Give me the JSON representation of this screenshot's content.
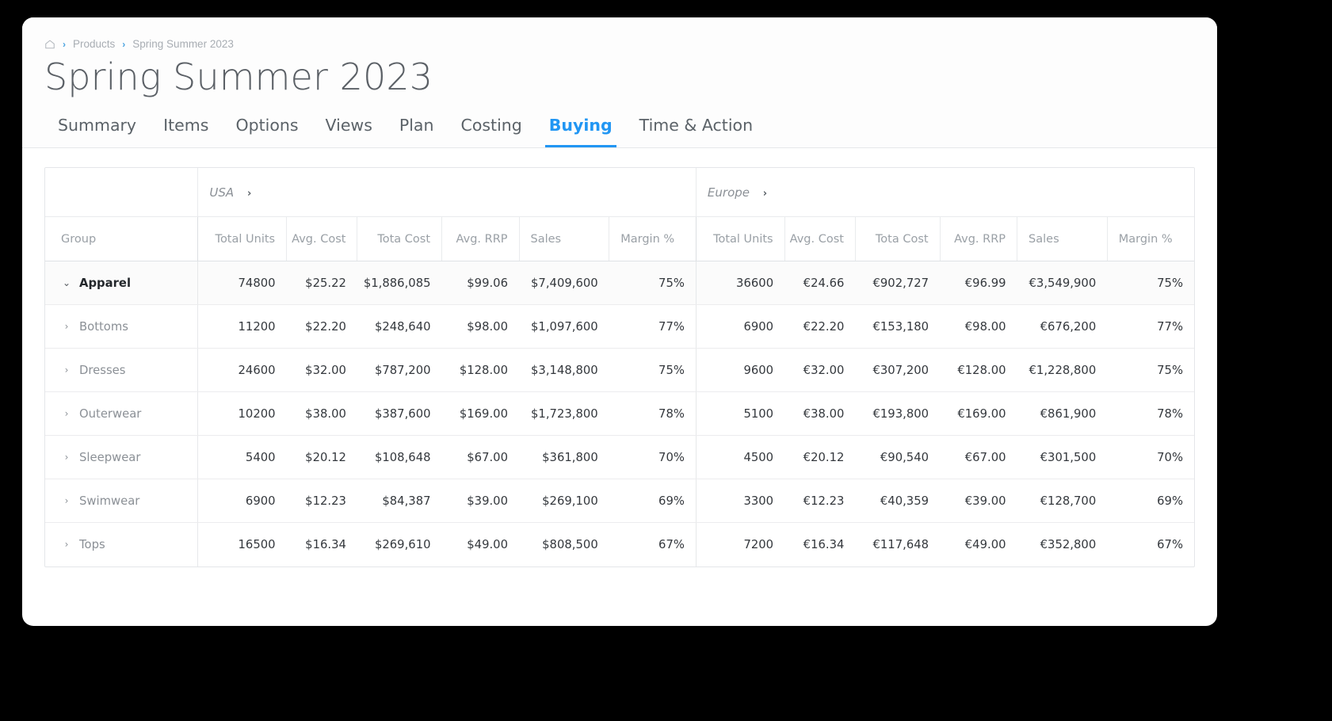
{
  "breadcrumb": {
    "home_icon": "home-icon",
    "separator": "›",
    "items": [
      "Products",
      "Spring Summer 2023"
    ]
  },
  "header": {
    "title": "Spring Summer 2023"
  },
  "tabs": [
    {
      "label": "Summary",
      "active": false
    },
    {
      "label": "Items",
      "active": false
    },
    {
      "label": "Options",
      "active": false
    },
    {
      "label": "Views",
      "active": false
    },
    {
      "label": "Plan",
      "active": false
    },
    {
      "label": "Costing",
      "active": false
    },
    {
      "label": "Buying",
      "active": true
    },
    {
      "label": "Time & Action",
      "active": false
    }
  ],
  "colors": {
    "accent": "#2196f3",
    "title_text": "#5b6066",
    "muted_text": "#9aa0a6",
    "body_text": "#34383d",
    "border": "#e4e6e9",
    "parent_row_bg": "#fbfbfb"
  },
  "table": {
    "regions": [
      {
        "name": "USA",
        "chevron": "›",
        "currency": "$"
      },
      {
        "name": "Europe",
        "chevron": "›",
        "currency": "€"
      }
    ],
    "group_header": "Group",
    "metric_headers": [
      "Total Units",
      "Avg. Cost",
      "Tota Cost",
      "Avg. RRP",
      "Sales",
      "Margin %"
    ],
    "rows": [
      {
        "group": "Apparel",
        "level": 0,
        "expanded": true,
        "chevron": "⌄",
        "usa": [
          "74800",
          "$25.22",
          "$1,886,085",
          "$99.06",
          "$7,409,600",
          "75%"
        ],
        "europe": [
          "36600",
          "€24.66",
          "€902,727",
          "€96.99",
          "€3,549,900",
          "75%"
        ]
      },
      {
        "group": "Bottoms",
        "level": 1,
        "expanded": false,
        "chevron": "›",
        "usa": [
          "11200",
          "$22.20",
          "$248,640",
          "$98.00",
          "$1,097,600",
          "77%"
        ],
        "europe": [
          "6900",
          "€22.20",
          "€153,180",
          "€98.00",
          "€676,200",
          "77%"
        ]
      },
      {
        "group": "Dresses",
        "level": 1,
        "expanded": false,
        "chevron": "›",
        "usa": [
          "24600",
          "$32.00",
          "$787,200",
          "$128.00",
          "$3,148,800",
          "75%"
        ],
        "europe": [
          "9600",
          "€32.00",
          "€307,200",
          "€128.00",
          "€1,228,800",
          "75%"
        ]
      },
      {
        "group": "Outerwear",
        "level": 1,
        "expanded": false,
        "chevron": "›",
        "usa": [
          "10200",
          "$38.00",
          "$387,600",
          "$169.00",
          "$1,723,800",
          "78%"
        ],
        "europe": [
          "5100",
          "€38.00",
          "€193,800",
          "€169.00",
          "€861,900",
          "78%"
        ]
      },
      {
        "group": "Sleepwear",
        "level": 1,
        "expanded": false,
        "chevron": "›",
        "usa": [
          "5400",
          "$20.12",
          "$108,648",
          "$67.00",
          "$361,800",
          "70%"
        ],
        "europe": [
          "4500",
          "€20.12",
          "€90,540",
          "€67.00",
          "€301,500",
          "70%"
        ]
      },
      {
        "group": "Swimwear",
        "level": 1,
        "expanded": false,
        "chevron": "›",
        "usa": [
          "6900",
          "$12.23",
          "$84,387",
          "$39.00",
          "$269,100",
          "69%"
        ],
        "europe": [
          "3300",
          "€12.23",
          "€40,359",
          "€39.00",
          "€128,700",
          "69%"
        ]
      },
      {
        "group": "Tops",
        "level": 1,
        "expanded": false,
        "chevron": "›",
        "usa": [
          "16500",
          "$16.34",
          "$269,610",
          "$49.00",
          "$808,500",
          "67%"
        ],
        "europe": [
          "7200",
          "€16.34",
          "€117,648",
          "€49.00",
          "€352,800",
          "67%"
        ]
      }
    ]
  }
}
